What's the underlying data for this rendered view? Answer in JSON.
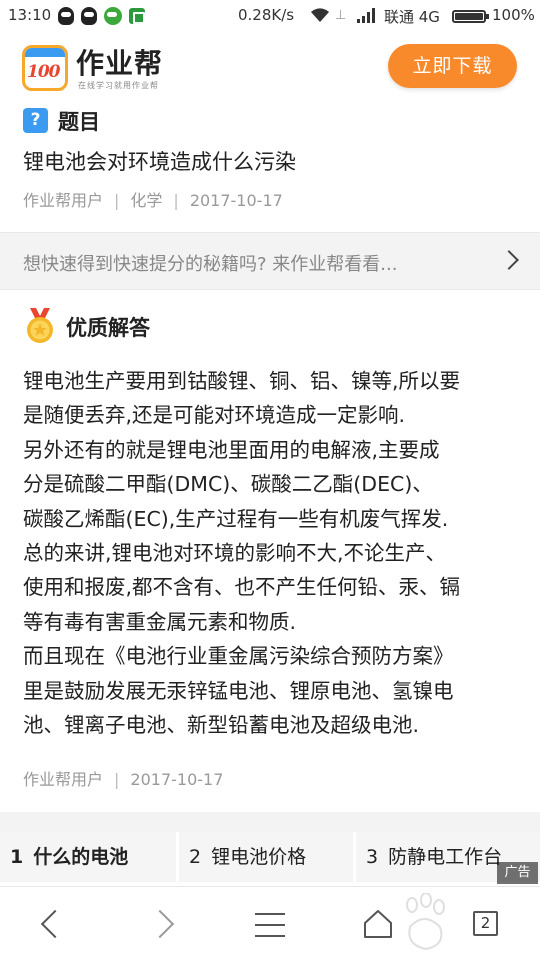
{
  "status_bar": {
    "time": "13:10",
    "net_speed": "0.28K/s",
    "carrier": "联通 4G",
    "battery": "100%"
  },
  "header": {
    "logo_badge": "100",
    "app_name": "作业帮",
    "tagline": "在线学习就用作业帮",
    "download_button": "立即下载"
  },
  "question": {
    "badge": "?",
    "section_label": "题目",
    "text": "锂电池会对环境造成什么污染",
    "author": "作业帮用户",
    "subject": "化学",
    "date": "2017-10-17"
  },
  "promo": {
    "text": "想快速得到快速提分的秘籍吗? 来作业帮看看..."
  },
  "answer": {
    "section_label": "优质解答",
    "lines": [
      "锂电池生产要用到钴酸锂、铜、铝、镍等,所以要",
      "是随便丢弃,还是可能对环境造成一定影响.",
      "另外还有的就是锂电池里面用的电解液,主要成",
      "分是硫酸二甲酯(DMC)、碳酸二乙酯(DEC)、",
      "碳酸乙烯酯(EC),生产过程有一些有机废气挥发.",
      "总的来讲,锂电池对环境的影响不大,不论生产、",
      "使用和报废,都不含有、也不产生任何铅、汞、镉",
      "等有毒有害重金属元素和物质.",
      "而且现在《电池行业重金属污染综合预防方案》",
      "里是鼓励发展无汞锌锰电池、锂原电池、氢镍电",
      "池、锂离子电池、新型铅蓄电池及超级电池."
    ],
    "author": "作业帮用户",
    "date": "2017-10-17"
  },
  "related": [
    {
      "num": "1",
      "label": "什么的电池"
    },
    {
      "num": "2",
      "label": "锂电池价格"
    },
    {
      "num": "3",
      "label": "防静电工作台"
    }
  ],
  "ad_label": "广告",
  "bottom_bar": {
    "tab_count": "2"
  }
}
